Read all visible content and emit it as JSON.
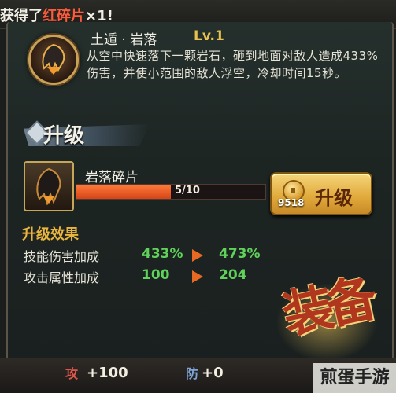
{
  "notification": {
    "prefix": "获得了",
    "item": "红碎片",
    "suffix": "×1!"
  },
  "skill": {
    "name": "土遁 · 岩落",
    "level": "Lv.1",
    "description": "从空中快速落下一颗岩石，砸到地面对敌人造成433%伤害，并使小范围的敌人浮空，冷却时间15秒。",
    "icon": "rock-fall-icon"
  },
  "upgrade": {
    "section_title": "升级",
    "material_name": "岩落碎片",
    "material_count": "5/10",
    "progress": 0.5,
    "button_label": "升级",
    "cost": "9518"
  },
  "effects": {
    "title": "升级效果",
    "rows": [
      {
        "label": "技能伤害加成",
        "old": "433%",
        "new": "473%"
      },
      {
        "label": "攻击属性加成",
        "old": "100",
        "new": "204"
      }
    ]
  },
  "seal": {
    "text": "装备"
  },
  "bottom_stats": {
    "attack_badge": "攻",
    "attack_value": "+100",
    "defense_badge": "防",
    "defense_value": "+0"
  },
  "watermark": "煎蛋手游",
  "colors": {
    "accent_gold": "#e8c24a",
    "increase_green": "#5fd25a",
    "notice_red": "#ff5a3a",
    "progress_orange": "#e2561f"
  }
}
